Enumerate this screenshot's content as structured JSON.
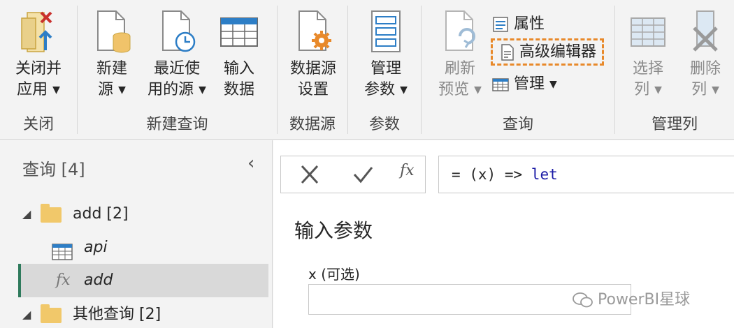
{
  "ribbon": {
    "close": {
      "label_line1": "关闭并",
      "label_line2": "应用",
      "group": "关闭"
    },
    "new_query": {
      "group": "新建查询",
      "new_source": {
        "line1": "新建",
        "line2": "源"
      },
      "recent_sources": {
        "line1": "最近使",
        "line2": "用的源"
      },
      "enter_data": {
        "line1": "输入",
        "line2": "数据"
      }
    },
    "data_sources": {
      "group": "数据源",
      "settings": {
        "line1": "数据源",
        "line2": "设置"
      }
    },
    "parameters": {
      "group": "参数",
      "manage": {
        "line1": "管理",
        "line2": "参数"
      }
    },
    "query": {
      "group": "查询",
      "refresh": {
        "line1": "刷新",
        "line2": "预览"
      },
      "properties": "属性",
      "advanced_editor": "高级编辑器",
      "manage": "管理"
    },
    "manage_columns": {
      "group": "管理列",
      "choose": {
        "line1": "选择",
        "line2": "列"
      },
      "remove": {
        "line1": "删除",
        "line2": "列"
      }
    }
  },
  "queries_pane": {
    "title": "查询 [4]",
    "items": [
      {
        "label": "add [2]",
        "type": "folder"
      },
      {
        "label": "api",
        "type": "table"
      },
      {
        "label": "add",
        "type": "function",
        "selected": true
      },
      {
        "label": "其他查询 [2]",
        "type": "folder"
      }
    ]
  },
  "formula_bar": {
    "fx_label": "fx",
    "text_prefix": "= (x) => ",
    "text_keyword": "let"
  },
  "parameters_panel": {
    "title": "输入参数",
    "param_label": "x (可选)",
    "param_value": ""
  },
  "watermark": "PowerBI星球",
  "colors": {
    "highlight_outline": "#e8892a",
    "selected_accent": "#2e7a5c",
    "keyword": "#1a1aa6"
  }
}
